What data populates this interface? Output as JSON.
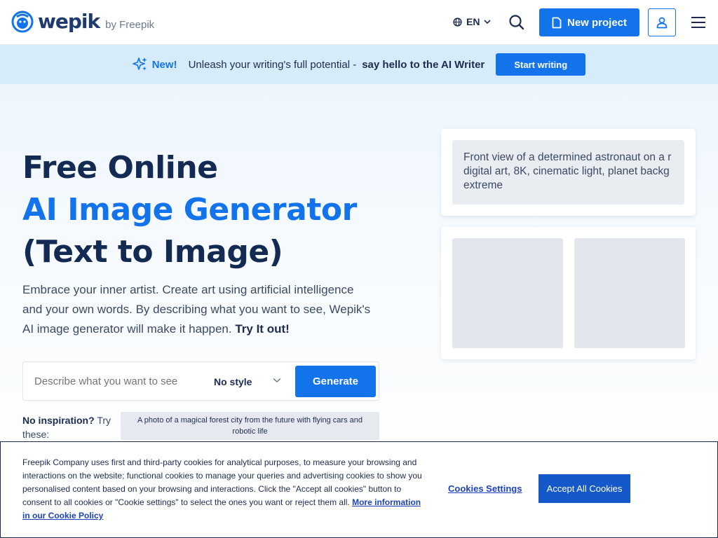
{
  "header": {
    "logo_text": "wepik",
    "logo_by": "by Freepik",
    "language": "EN",
    "new_project_label": "New project"
  },
  "banner": {
    "new_label": "New!",
    "text": "Unleash your writing's full potential -",
    "strong_text": "say hello to the AI Writer",
    "button_label": "Start writing"
  },
  "hero": {
    "title_line1": "Free Online",
    "title_line2": "AI Image Generator",
    "title_line3": "(Text to Image)",
    "lead": "Embrace your inner artist. Create art using artificial intelligence and your own words. By describing what you want to see, Wepik's AI image generator will make it happen.",
    "lead_strong": "Try It out!"
  },
  "generator": {
    "input_placeholder": "Describe what you want to see",
    "style_value": "No style",
    "generate_label": "Generate"
  },
  "inspiration": {
    "label_strong": "No inspiration?",
    "label_rest": "Try these:",
    "chip_text": "A photo of a magical forest city from the future with flying cars and robotic life"
  },
  "preview": {
    "prompt_line1": "Front view of a determined astronaut on a r",
    "prompt_line2": "digital art, 8K, cinematic light, planet backg",
    "prompt_line3": "extreme"
  },
  "cookie": {
    "text": "Freepik Company uses first and third-party cookies for analytical purposes, to measure your browsing and interactions on the website; functional cookies to manage your queries and advertising cookies to show you personalised content based on your browsing and interactions. Click the \"Accept all cookies\" button to consent to all cookies or \"Cookie settings\" to select the ones you want or reject them all.",
    "link_text": "More information in our Cookie Policy",
    "settings_label": "Cookies Settings",
    "accept_label": "Accept All Cookies"
  },
  "colors": {
    "primary": "#1273eb",
    "navy": "#132a52",
    "banner_bg": "#d6ecfb"
  }
}
